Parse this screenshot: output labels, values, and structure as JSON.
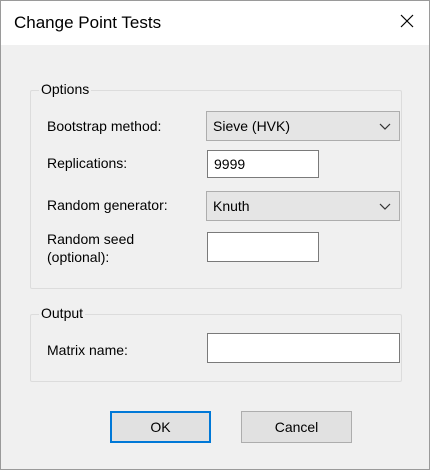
{
  "window": {
    "title": "Change Point Tests"
  },
  "options": {
    "group_title": "Options",
    "bootstrap": {
      "label": "Bootstrap method:",
      "value": "Sieve (HVK)"
    },
    "replications": {
      "label": "Replications:",
      "value": "9999"
    },
    "generator": {
      "label": "Random generator:",
      "value": "Knuth"
    },
    "seed": {
      "label_line1": "Random seed",
      "label_line2": "(optional):",
      "value": ""
    }
  },
  "output": {
    "group_title": "Output",
    "matrix": {
      "label": "Matrix name:",
      "value": ""
    }
  },
  "buttons": {
    "ok": "OK",
    "cancel": "Cancel"
  },
  "icons": {
    "close": "close-icon",
    "dropdown": "chevron-down-icon"
  }
}
